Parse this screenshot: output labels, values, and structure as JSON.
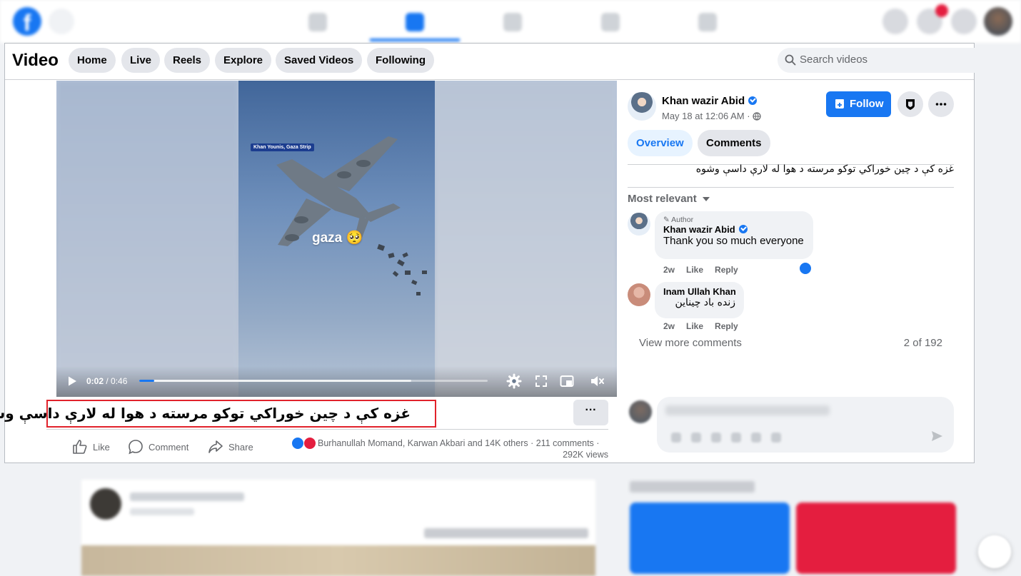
{
  "topbar": {
    "logo": "f",
    "nav_icons": [
      "home-icon",
      "video-icon",
      "marketplace-icon",
      "groups-icon",
      "gaming-icon"
    ],
    "active_nav": "video-icon",
    "right_icons": [
      "menu-icon",
      "messenger-icon",
      "notifications-icon",
      "account-avatar"
    ]
  },
  "video_header": {
    "title": "Video",
    "tabs": [
      "Home",
      "Live",
      "Reels",
      "Explore",
      "Saved Videos",
      "Following"
    ],
    "search_placeholder": "Search videos"
  },
  "video": {
    "location_tag": "Khan Younis, Gaza Strip",
    "overlay_text": "gaza 🥺",
    "current_time": "0:02",
    "duration": "0:46",
    "progress": 0.043,
    "buffered": 0.78
  },
  "post": {
    "caption": "غزه کې د چین خوراکي توکو مرسته د هوا له لارې داسې وشوه",
    "more_label": "···",
    "actions": {
      "like": "Like",
      "comment": "Comment",
      "share": "Share"
    },
    "reactions_text": "Burhanullah Momand, Karwan Akbari and 14K others",
    "comments_count": "211 comments",
    "views": "292K views"
  },
  "author": {
    "name": "Khan wazir Abid",
    "date": "May 18 at 12:06 AM ·",
    "follow_label": "Follow"
  },
  "sidebar_tabs": {
    "overview": "Overview",
    "comments": "Comments"
  },
  "sidebar_caption": "غزه کې د چین خوراکي توکو مرسته د هوا له لارې داسې وشوه",
  "comments": {
    "sort_label": "Most relevant",
    "items": [
      {
        "badge": "Author",
        "name": "Khan wazir Abid",
        "text": "Thank you so much everyone",
        "age": "2w",
        "like": "Like",
        "reply": "Reply"
      },
      {
        "name": "Inam Ullah Khan",
        "text": "زنده باد چیناین",
        "age": "2w",
        "like": "Like",
        "reply": "Reply"
      }
    ],
    "view_more": "View more comments",
    "count": "2 of 192"
  },
  "colors": {
    "brand_blue": "#1877f2",
    "caption_highlight": "#e1222b",
    "love_red": "#e41e3f"
  }
}
